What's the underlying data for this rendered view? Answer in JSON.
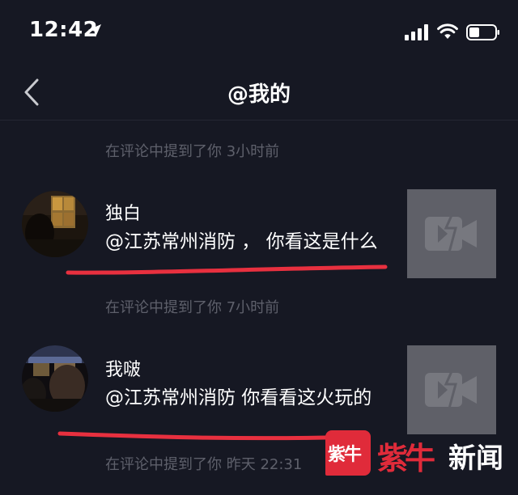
{
  "status_bar": {
    "time": "12:42",
    "icons": [
      "location-arrow-icon",
      "cellular-signal-icon",
      "wifi-icon",
      "battery-icon"
    ]
  },
  "nav": {
    "title": "@我的",
    "back_icon": "chevron-left-icon"
  },
  "feed": {
    "header_meta": "在评论中提到了你  3小时前",
    "mentions": [
      {
        "username": "独白",
        "comment": "@江苏常州消防 ， 你看这是什么",
        "meta": "在评论中提到了你  7小时前",
        "thumbnail_icon": "video-placeholder-icon"
      },
      {
        "username": "我啵",
        "comment": "@江苏常州消防 你看看这火玩的",
        "meta": "在评论中提到了你  昨天 22:31",
        "thumbnail_icon": "video-placeholder-icon"
      }
    ]
  },
  "watermark": {
    "badge": "紫牛",
    "logo": "紫牛",
    "word": "新闻"
  },
  "colors": {
    "background": "#161823",
    "meta_text": "#5e606b",
    "thumbnail": "#5f6068",
    "annotation_red": "#e8303f",
    "watermark_red": "#e02b3a"
  }
}
